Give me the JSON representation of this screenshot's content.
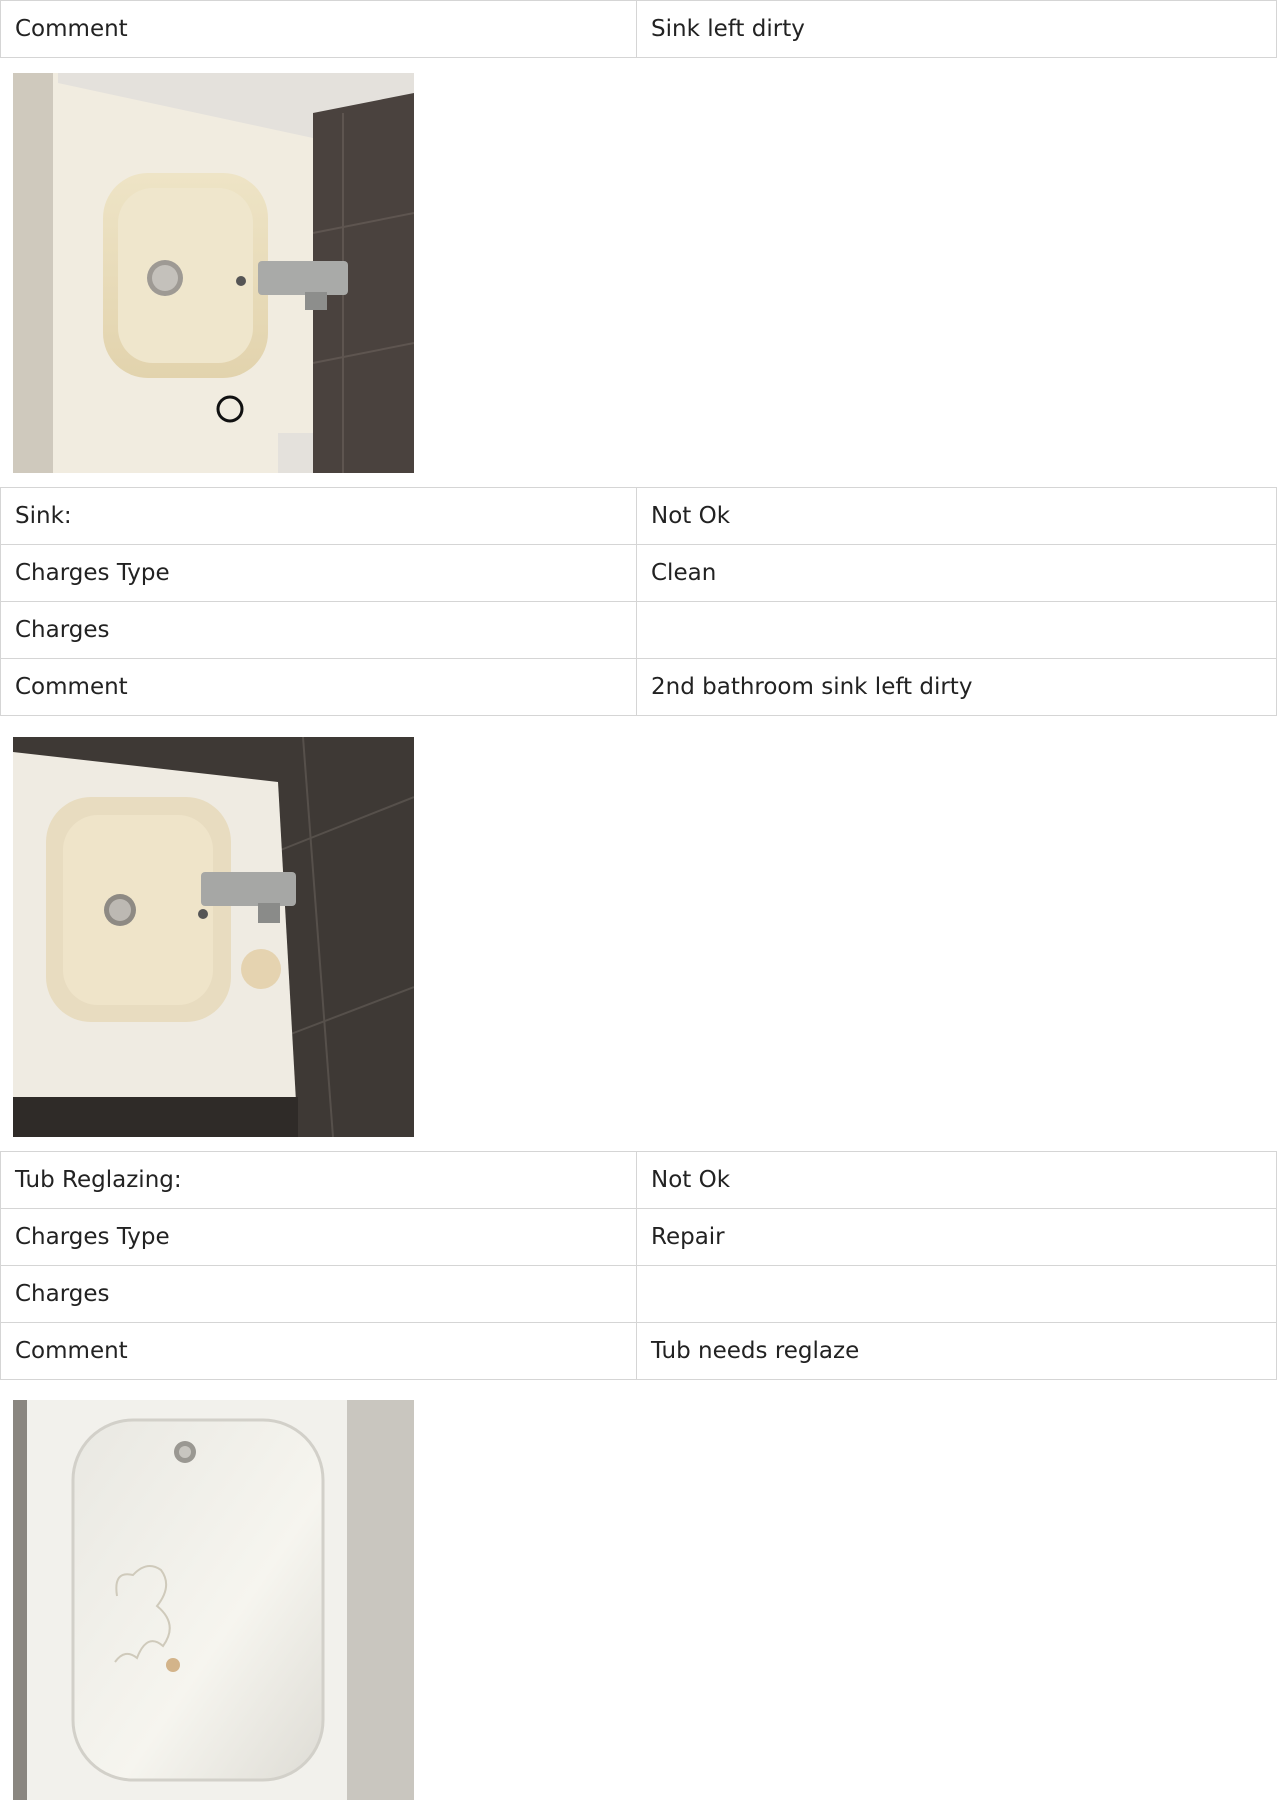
{
  "section0": {
    "comment_label": "Comment",
    "comment_value": "Sink left dirty"
  },
  "section1": {
    "item_label": "Sink:",
    "item_status": "Not Ok",
    "charges_type_label": "Charges Type",
    "charges_type_value": "Clean",
    "charges_label": "Charges",
    "charges_value": "",
    "comment_label": "Comment",
    "comment_value": "2nd bathroom sink left dirty"
  },
  "section2": {
    "item_label": "Tub Reglazing:",
    "item_status": "Not Ok",
    "charges_type_label": "Charges Type",
    "charges_type_value": "Repair",
    "charges_label": "Charges",
    "charges_value": "",
    "comment_label": "Comment",
    "comment_value": "Tub needs reglaze"
  },
  "colors": {
    "border": "#d5d5d5",
    "text": "#222222",
    "background": "#ffffff"
  }
}
